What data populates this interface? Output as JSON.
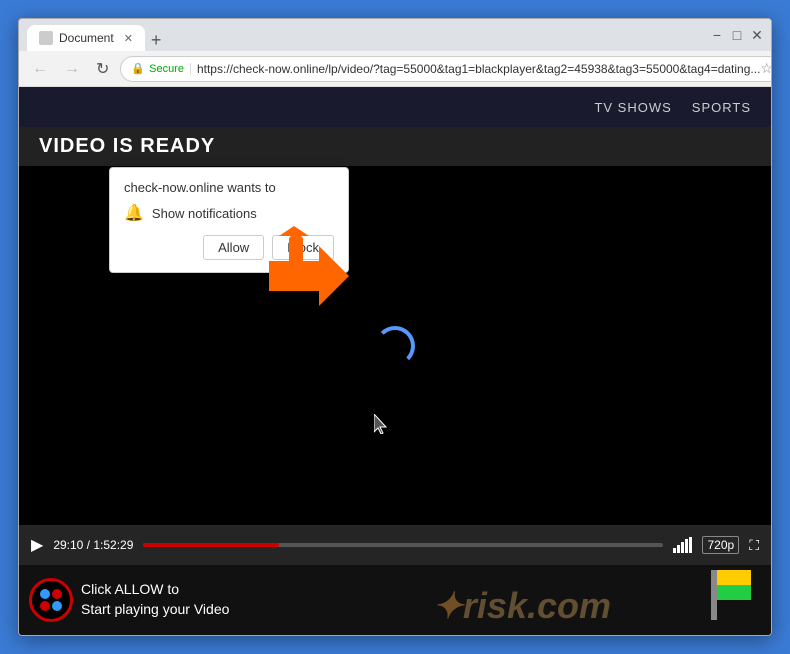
{
  "window": {
    "title": "Document",
    "tab_label": "Document"
  },
  "browser": {
    "back_label": "←",
    "forward_label": "→",
    "reload_label": "↻",
    "secure_label": "Secure",
    "url": "https://check-now.online/lp/video/?tag=55000&tag1=blackplayer&tag2=45938&tag3=55000&tag4=dating...",
    "star_label": "☆",
    "profile_label": "⊙",
    "menu_label": "⋮"
  },
  "site": {
    "nav_items": [
      "TV SHOWS",
      "SPORTS"
    ],
    "video_title": "VIDEO IS READY"
  },
  "video_controls": {
    "play_label": "▶",
    "time_current": "29:10",
    "time_total": "1:52:29",
    "time_separator": " / ",
    "quality": "720p",
    "fullscreen_label": "⛶"
  },
  "notification_popup": {
    "title": "check-now.online wants to",
    "bell_icon": "🔔",
    "permission_text": "Show notifications",
    "allow_label": "Allow",
    "block_label": "Block"
  },
  "watermark": {
    "cta_line1": "lick ALLOW to",
    "cta_line2": "tart playing your Video",
    "brand": "risk.com"
  }
}
